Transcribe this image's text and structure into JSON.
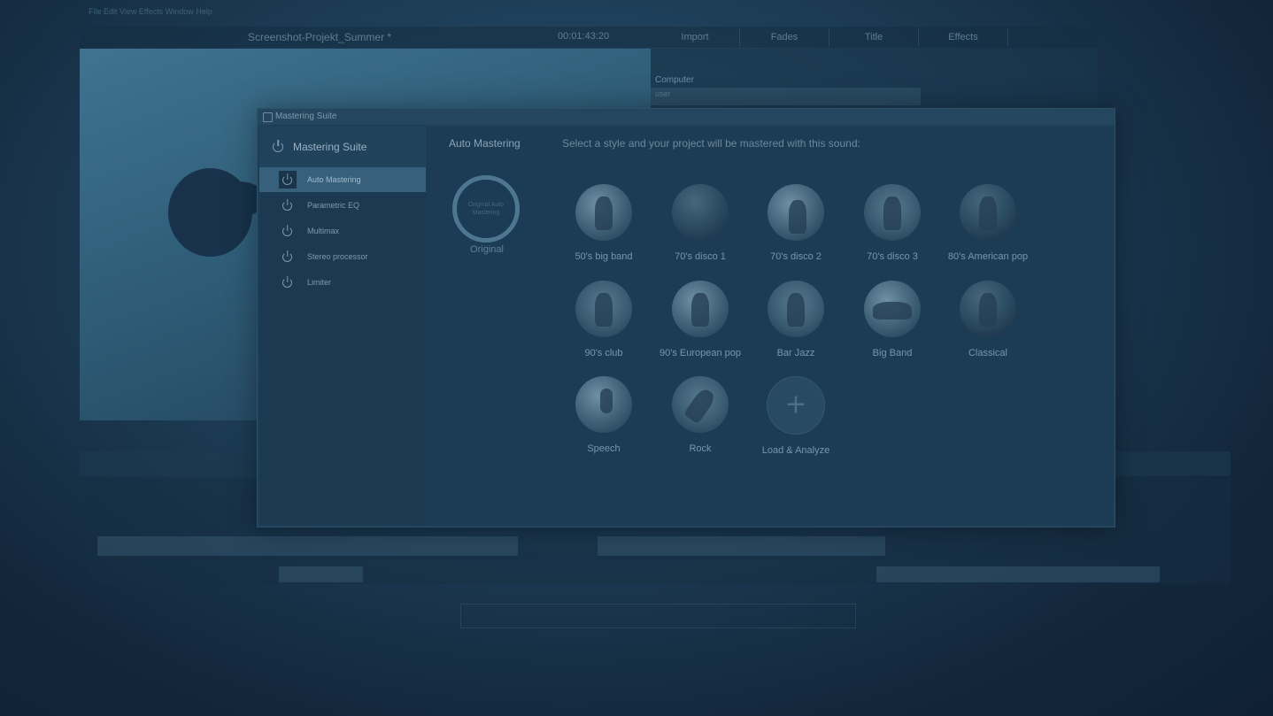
{
  "editor": {
    "menubar": "File  Edit  View  Effects  Window  Help",
    "project_title": "Screenshot-Projekt_Summer *",
    "time": "00:01:43:20",
    "top_tabs": [
      "Import",
      "Fades",
      "Title",
      "Effects"
    ],
    "right_label": "Computer",
    "right_sub": "user"
  },
  "dialog": {
    "title": "Mastering Suite",
    "sidebar": {
      "header": "Mastering Suite",
      "items": [
        {
          "label": "Auto Mastering",
          "active": true
        },
        {
          "label": "Parametric EQ"
        },
        {
          "label": "Multimax"
        },
        {
          "label": "Stereo processor"
        },
        {
          "label": "Limiter"
        }
      ]
    },
    "section_title": "Auto Mastering",
    "instruction": "Select a style and your project will be mastered with this sound:",
    "original": {
      "ring_text": "Original Auto Mastering",
      "label": "Original"
    },
    "styles": [
      {
        "label": "50's big band",
        "icon": "big-band-thumb"
      },
      {
        "label": "70's disco 1",
        "icon": "disco-thumb"
      },
      {
        "label": "70's disco 2",
        "icon": "disco-thumb"
      },
      {
        "label": "70's disco 3",
        "icon": "disco-thumb"
      },
      {
        "label": "80's American pop",
        "icon": "pop-thumb"
      },
      {
        "label": "90's club",
        "icon": "club-thumb"
      },
      {
        "label": "90's European pop",
        "icon": "pop-thumb"
      },
      {
        "label": "Bar Jazz",
        "icon": "jazz-thumb"
      },
      {
        "label": "Big Band",
        "icon": "big-band-thumb"
      },
      {
        "label": "Classical",
        "icon": "classical-thumb"
      },
      {
        "label": "Speech",
        "icon": "microphone-thumb"
      },
      {
        "label": "Rock",
        "icon": "guitar-thumb"
      },
      {
        "label": "Load & Analyze",
        "icon": "plus-icon"
      }
    ]
  }
}
